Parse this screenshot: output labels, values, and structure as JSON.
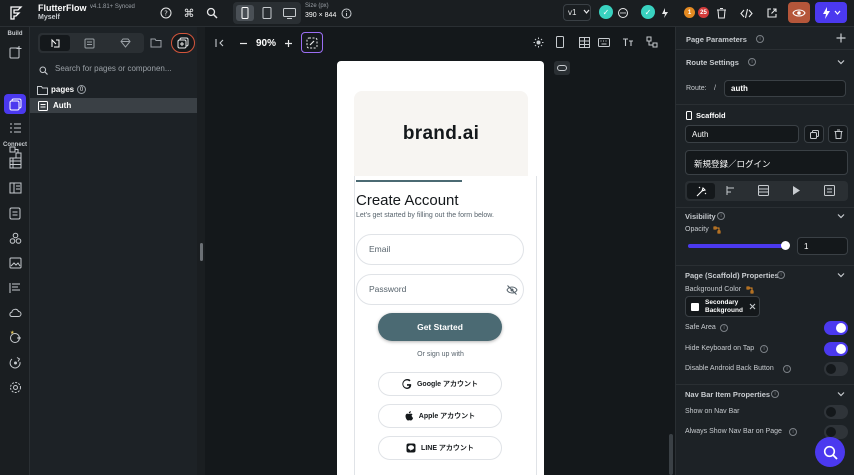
{
  "topbar": {
    "app_name": "FlutterFlow",
    "version": "v4.1.81+",
    "sync_status": "Synced",
    "workspace": "Myself",
    "size_label": "Size (px)",
    "size_value": "390 × 844",
    "app_version_select": "v1",
    "badge_count_orange": "1",
    "badge_count_red": "25"
  },
  "rail": {
    "build_label": "Build",
    "connect_label": "Connect"
  },
  "panel": {
    "search_placeholder": "Search for pages or componen...",
    "folder_label": "pages",
    "folder_count": "0",
    "page_name": "Auth"
  },
  "canvas": {
    "zoom": "90%"
  },
  "phone": {
    "brand": "brand.ai",
    "title": "Create Account",
    "subtitle": "Let's get started by filling out the form below.",
    "email_placeholder": "Email",
    "password_placeholder": "Password",
    "primary_button": "Get Started",
    "or_text": "Or sign up with",
    "google_button": "Google アカウント",
    "apple_button": "Apple アカウント",
    "line_button": "LINE アカウント"
  },
  "props": {
    "page_parameters": "Page Parameters",
    "route_settings": "Route Settings",
    "route_label": "Route:",
    "route_slash": "/",
    "route_value": "auth",
    "scaffold_label": "Scaffold",
    "scaffold_name": "Auth",
    "scaffold_title": "新規登録／ログイン",
    "visibility": "Visibility",
    "opacity_label": "Opacity",
    "opacity_value": "1",
    "opacity_slider_fraction": 1.0,
    "scaffold_props": "Page (Scaffold) Properties",
    "bg_color_label": "Background Color",
    "bg_color_line1": "Secondary",
    "bg_color_line2": "Background",
    "safe_area": "Safe Area",
    "hide_keyboard": "Hide Keyboard on Tap",
    "disable_back": "Disable Android Back Button",
    "nav_bar_props": "Nav Bar Item Properties",
    "show_nav": "Show on Nav Bar",
    "always_show_nav": "Always Show Nav Bar on Page",
    "toggles": {
      "safe_area": true,
      "hide_keyboard": true,
      "disable_back": false,
      "show_nav": false,
      "always_show_nav": false
    }
  },
  "colors": {
    "accent": "#4b39ef",
    "primary_button": "#4b6a73",
    "success": "#39d2c0",
    "preview": "#b5563a"
  }
}
